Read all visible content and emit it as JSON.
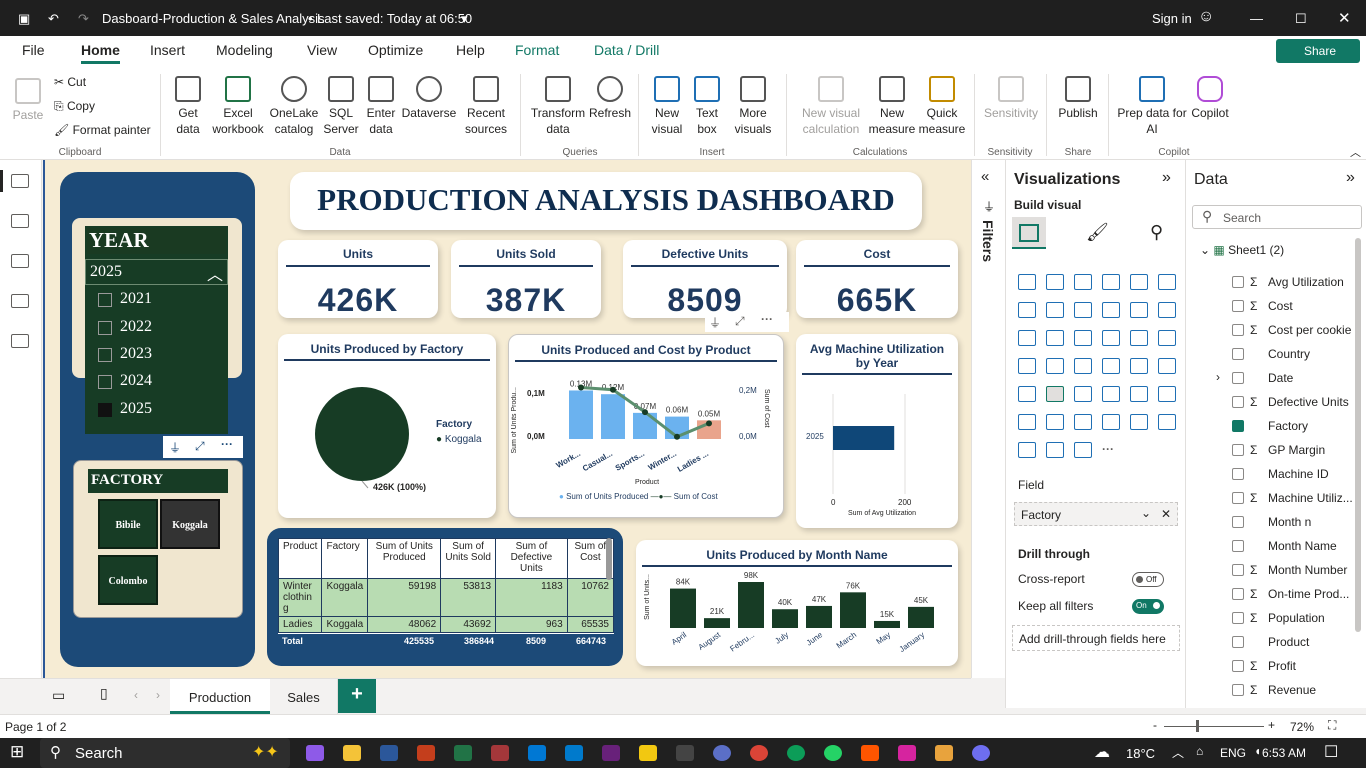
{
  "app": {
    "title": "Dasboard-Production & Sales Analysis",
    "saved": "Last saved: Today at 06:50",
    "sign_in": "Sign in"
  },
  "tabs": [
    "File",
    "Home",
    "Insert",
    "Modeling",
    "View",
    "Optimize",
    "Help",
    "Format",
    "Data / Drill"
  ],
  "share": "Share",
  "ribbon": {
    "clipboard": {
      "paste": "Paste",
      "cut": "Cut",
      "copy": "Copy",
      "format_painter": "Format painter",
      "group": "Clipboard"
    },
    "data": {
      "items": [
        "Get data",
        "Excel workbook",
        "OneLake catalog",
        "SQL Server",
        "Enter data",
        "Dataverse",
        "Recent sources"
      ],
      "group": "Data"
    },
    "queries": {
      "items": [
        "Transform data",
        "Refresh"
      ],
      "group": "Queries"
    },
    "insert": {
      "items": [
        "New visual",
        "Text box",
        "More visuals"
      ],
      "group": "Insert"
    },
    "calculations": {
      "items": [
        "New visual calculation",
        "New measure",
        "Quick measure"
      ],
      "group": "Calculations"
    },
    "sensitivity": {
      "items": [
        "Sensitivity"
      ],
      "group": "Sensitivity"
    },
    "share": {
      "items": [
        "Publish"
      ],
      "group": "Share"
    },
    "copilot": {
      "items": [
        "Prep data for AI",
        "Copilot"
      ],
      "group": "Copilot"
    }
  },
  "dashboard": {
    "title": "PRODUCTION ANALYSIS DASHBOARD",
    "kpis": [
      {
        "label": "Units",
        "value": "426K"
      },
      {
        "label": "Units Sold",
        "value": "387K"
      },
      {
        "label": "Defective Units",
        "value": "8509"
      },
      {
        "label": "Cost",
        "value": "665K"
      }
    ],
    "year_slicer": {
      "title": "YEAR",
      "selected": "2025",
      "options": [
        "2021",
        "2022",
        "2023",
        "2024",
        "2025"
      ]
    },
    "factory_slicer": {
      "title": "FACTORY",
      "options": [
        "Bibile",
        "Koggala",
        "Colombo"
      ]
    },
    "pie": {
      "title": "Units Produced by Factory",
      "legend_title": "Factory",
      "legend_item": "Koggala",
      "label": "426K (100%)"
    },
    "combo": {
      "title": "Units Produced and Cost by Product",
      "y_left": "Sum of Units Produ...",
      "y_right": "Sum of Cost",
      "x_label": "Product",
      "legend": [
        "Sum of Units Produced",
        "Sum of Cost"
      ],
      "left_ticks": [
        "0,1M",
        "0,0M"
      ],
      "right_ticks": [
        "0,2M",
        "0,0M"
      ]
    },
    "machine": {
      "title": "Avg Machine Utilization by Year",
      "category": "2025",
      "x_ticks": [
        "0",
        "200"
      ],
      "x_label": "Sum of Avg Utilization"
    },
    "table": {
      "headers": [
        "Product",
        "Factory",
        "Sum of Units Produced",
        "Sum of Units Sold",
        "Sum of Defective Units",
        "Sum of Cost"
      ],
      "rows": [
        [
          "Winter clothin g",
          "Koggala",
          "59198",
          "53813",
          "1183",
          "10762"
        ],
        [
          "Ladies",
          "Koggala",
          "48062",
          "43692",
          "963",
          "65535"
        ]
      ],
      "total": [
        "Total",
        "",
        "425535",
        "386844",
        "8509",
        "664743"
      ]
    },
    "month": {
      "title": "Units Produced by Month Name",
      "y_label": "Sum of Units..."
    }
  },
  "chart_data": [
    {
      "type": "pie",
      "title": "Units Produced by Factory",
      "categories": [
        "Koggala"
      ],
      "values": [
        426000
      ]
    },
    {
      "type": "bar",
      "title": "Units Produced and Cost by Product",
      "categories": [
        "Work...",
        "Casual...",
        "Sports...",
        "Winter...",
        "Ladies ..."
      ],
      "series": [
        {
          "name": "Sum of Units Produced",
          "values": [
            0.13,
            0.12,
            0.07,
            0.06,
            0.05
          ],
          "labels": [
            "0.13M",
            "0.12M",
            "0.07M",
            "0.06M",
            "0.05M"
          ]
        },
        {
          "name": "Sum of Cost",
          "type": "line",
          "values": [
            0.23,
            0.22,
            0.12,
            0.01,
            0.07
          ]
        }
      ],
      "ylabel": "Sum of Units Produ...",
      "xlabel": "Product",
      "ylim": [
        0,
        0.15
      ]
    },
    {
      "type": "bar",
      "title": "Avg Machine Utilization by Year",
      "categories": [
        "2025"
      ],
      "values": [
        170
      ],
      "xlim": [
        0,
        200
      ],
      "xlabel": "Sum of Avg Utilization"
    },
    {
      "type": "bar",
      "title": "Units Produced by Month Name",
      "categories": [
        "April",
        "August",
        "Febru...",
        "July",
        "June",
        "March",
        "May",
        "January"
      ],
      "values": [
        84,
        21,
        98,
        40,
        47,
        76,
        15,
        45
      ],
      "labels": [
        "84K",
        "21K",
        "98K",
        "40K",
        "47K",
        "76K",
        "15K",
        "45K"
      ],
      "ylabel": "Sum of Units..."
    }
  ],
  "visualizations": {
    "title": "Visualizations",
    "build": "Build visual",
    "field_label": "Field",
    "field_value": "Factory",
    "drill": "Drill through",
    "cross": "Cross-report",
    "cross_state": "Off",
    "keep": "Keep all filters",
    "keep_state": "On",
    "add_drill": "Add drill-through fields here"
  },
  "filters": "Filters",
  "data_pane": {
    "title": "Data",
    "search": "Search",
    "table": "Sheet1 (2)",
    "fields": [
      "Avg Utilization",
      "Cost",
      "Cost per cookie",
      "Country",
      "Date",
      "Defective Units",
      "Factory",
      "GP Margin",
      "Machine ID",
      "Machine Utiliz...",
      "Month n",
      "Month Name",
      "Month Number",
      "On-time Prod...",
      "Population",
      "Product",
      "Profit",
      "Revenue"
    ]
  },
  "pages": [
    "Production",
    "Sales"
  ],
  "status": {
    "page": "Page 1 of 2",
    "zoom": "72%"
  },
  "taskbar": {
    "search": "Search",
    "temp": "18°C",
    "lang": "ENG",
    "time": "6:53 AM"
  }
}
